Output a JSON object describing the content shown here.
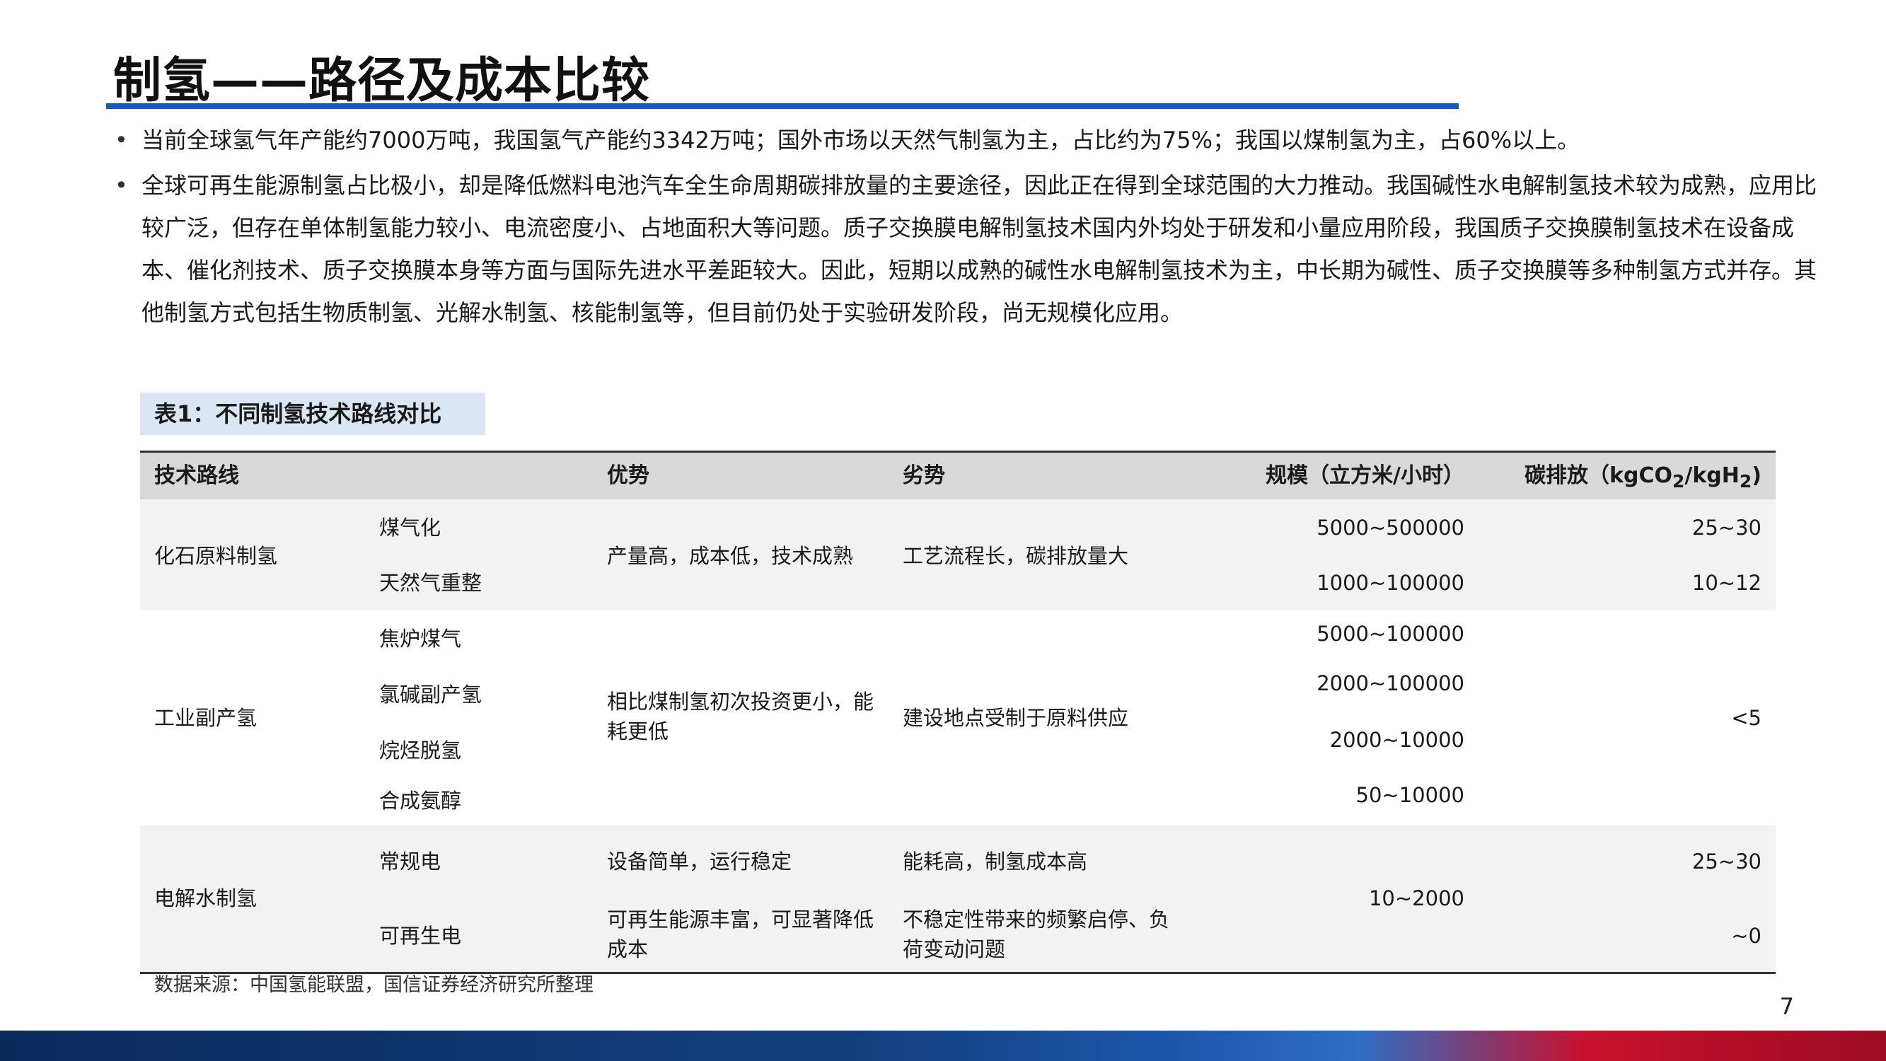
{
  "title": "制氢——路径及成本比较",
  "bullets": [
    "当前全球氢气年产能约7000万吨，我国氢气产能约3342万吨；国外市场以天然气制氢为主，占比约为75%；我国以煤制氢为主，占60%以上。",
    "全球可再生能源制氢占比极小，却是降低燃料电池汽车全生命周期碳排放量的主要途径，因此正在得到全球范围的大力推动。我国碱性水电解制氢技术较为成熟，应用比较广泛，但存在单体制氢能力较小、电流密度小、占地面积大等问题。质子交换膜电解制氢技术国内外均处于研发和小量应用阶段，我国质子交换膜制氢技术在设备成本、催化剂技术、质子交换膜本身等方面与国际先进水平差距较大。因此，短期以成熟的碱性水电解制氢技术为主，中长期为碱性、质子交换膜等多种制氢方式并存。其他制氢方式包括生物质制氢、光解水制氢、核能制氢等，但目前仍处于实验研发阶段，尚无规模化应用。"
  ],
  "table_caption": "表1：不同制氢技术路线对比",
  "table": {
    "headers": {
      "route": "技术路线",
      "advantage": "优势",
      "disadvantage": "劣势",
      "scale": "规模（立方米/小时）",
      "carbon_prefix": "碳排放（kgCO",
      "carbon_sub1": "2",
      "carbon_mid": "/kgH",
      "carbon_sub2": "2",
      "carbon_suffix": ")"
    },
    "groups": [
      {
        "route": "化石原料制氢",
        "subs": [
          "煤气化",
          "天然气重整"
        ],
        "advantage": "产量高，成本低，技术成熟",
        "disadvantage": "工艺流程长，碳排放量大",
        "scales": [
          "5000~500000",
          "1000~100000"
        ],
        "carbons": [
          "25~30",
          "10~12"
        ]
      },
      {
        "route": "工业副产氢",
        "subs": [
          "焦炉煤气",
          "氯碱副产氢",
          "烷烃脱氢",
          "合成氨醇"
        ],
        "advantage": "相比煤制氢初次投资更小，能耗更低",
        "disadvantage": "建设地点受制于原料供应",
        "scales": [
          "5000~100000",
          "2000~100000",
          "2000~10000",
          "50~10000"
        ],
        "carbon": "<5"
      },
      {
        "route": "电解水制氢",
        "subs": [
          "常规电",
          "可再生电"
        ],
        "advantages": [
          "设备简单，运行稳定",
          "可再生能源丰富，可显著降低成本"
        ],
        "disadvantages": [
          "能耗高，制氢成本高",
          "不稳定性带来的频繁启停、负荷变动问题"
        ],
        "scale": "10~2000",
        "carbons": [
          "25~30",
          "~0"
        ]
      }
    ]
  },
  "source": "数据来源：中国氢能联盟，国信证券经济研究所整理",
  "page_number": "7",
  "colors": {
    "title_rule": "#1d5aa6",
    "caption_bg": "#dbe6f4",
    "header_bg": "#d9d9d9",
    "row_shade": "#f2f2f2"
  }
}
